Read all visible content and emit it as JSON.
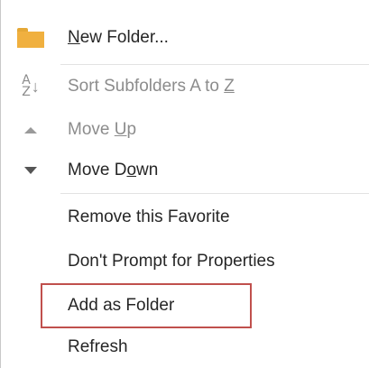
{
  "menu": {
    "items": [
      {
        "pre": "",
        "mnemonic": "N",
        "post": "ew Folder...",
        "icon": "folder-icon",
        "enabled": true
      },
      {
        "pre": "Sort Subfolders A to ",
        "mnemonic": "Z",
        "post": "",
        "icon": "sort-az-icon",
        "enabled": false
      },
      {
        "pre": "Move ",
        "mnemonic": "U",
        "post": "p",
        "icon": "move-up-icon",
        "enabled": false
      },
      {
        "pre": "Move D",
        "mnemonic": "o",
        "post": "wn",
        "icon": "move-down-icon",
        "enabled": true
      },
      {
        "label": "Remove this Favorite",
        "enabled": true
      },
      {
        "label": "Don't Prompt for Properties",
        "enabled": true
      },
      {
        "label": "Add as Folder",
        "enabled": true,
        "highlighted": true
      },
      {
        "label": "Refresh",
        "enabled": true
      }
    ],
    "sort_icon_top": "A",
    "sort_icon_bottom": "Z",
    "highlight_color": "#c0504d",
    "folder_color": "#f0b03f"
  }
}
